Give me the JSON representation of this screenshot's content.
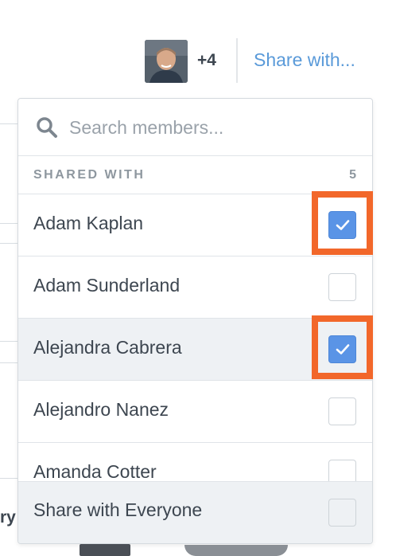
{
  "header": {
    "extra_count": "+4",
    "share_link": "Share with..."
  },
  "search": {
    "placeholder": "Search members...",
    "value": ""
  },
  "section": {
    "title": "SHARED WITH",
    "count": "5"
  },
  "members": [
    {
      "name": "Adam Kaplan",
      "checked": true
    },
    {
      "name": "Adam Sunderland",
      "checked": false
    },
    {
      "name": "Alejandra Cabrera",
      "checked": true
    },
    {
      "name": "Alejandro Nanez",
      "checked": false
    },
    {
      "name": "Amanda Cotter",
      "checked": false
    }
  ],
  "footer": {
    "label": "Share with Everyone",
    "checked": false
  },
  "background": {
    "peek_text": "ry"
  },
  "colors": {
    "accent": "#5a94e6",
    "link": "#5a9ad9",
    "highlight": "#f2672a"
  }
}
